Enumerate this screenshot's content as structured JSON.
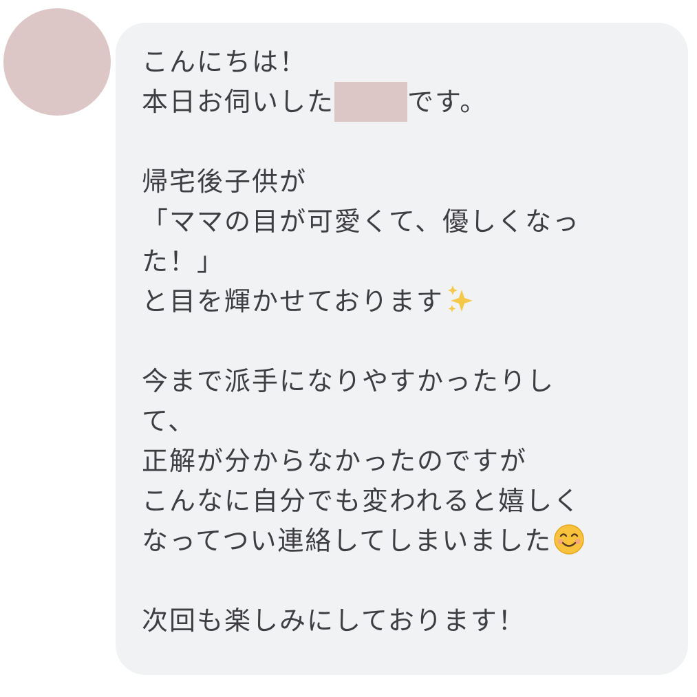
{
  "message": {
    "lines": [
      "こんにちは！",
      "本日お伺いした",
      "です。",
      "",
      "帰宅後子供が",
      "「ママの目が可愛くて、優しくなっ",
      "た！」",
      "と目を輝かせております",
      "",
      "今まで派手になりやすかったりし",
      "て、",
      "正解が分からなかったのですが",
      "こんなに自分でも変われると嬉しく",
      "なってつい連絡してしまいました",
      "",
      "次回も楽しみにしております！"
    ],
    "emojis": {
      "line8": "sparkles-icon",
      "line14": "smiling-face-icon"
    }
  },
  "colors": {
    "bubble": "#f1f2f4",
    "avatar": "#dcc7c6",
    "redaction": "#dcc7c6",
    "text": "#3e3e42"
  }
}
